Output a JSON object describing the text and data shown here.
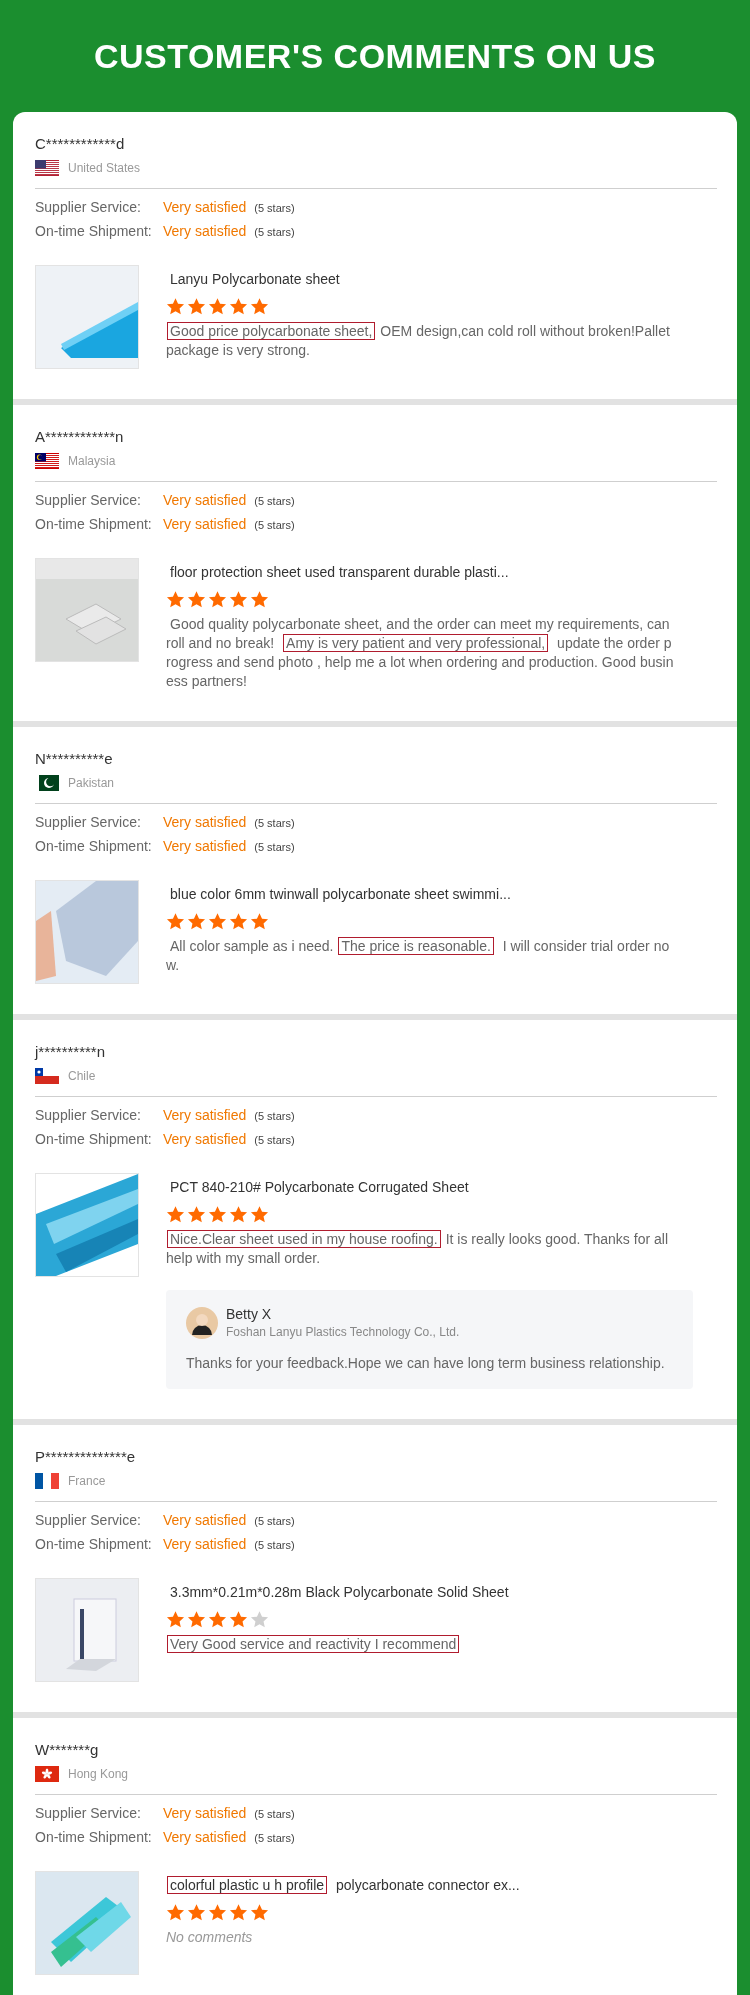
{
  "header": {
    "title": "CUSTOMER'S COMMENTS ON US"
  },
  "reviews": [
    {
      "name": "C************d",
      "country": "United States",
      "flag": {
        "kind": "us"
      },
      "ratings": [
        {
          "label": "Supplier Service:",
          "value": "Very satisfied",
          "note": "(5 stars)"
        },
        {
          "label": "On-time Shipment:",
          "value": "Very satisfied",
          "note": "(5 stars)"
        }
      ],
      "product": {
        "title": [
          {
            "text": "Lanyu Polycarbonate sheet",
            "highlighted": false
          }
        ],
        "stars": 5
      },
      "comment": {
        "kind": "text",
        "parts": [
          {
            "text": "Good price polycarbonate sheet,",
            "highlighted": true
          },
          {
            "text": "OEM design,can cold roll without broken!Pallet package is very strong.",
            "highlighted": false
          }
        ]
      }
    },
    {
      "name": "A************n",
      "country": "Malaysia",
      "flag": {
        "kind": "my"
      },
      "ratings": [
        {
          "label": "Supplier Service:",
          "value": "Very satisfied",
          "note": "(5 stars)"
        },
        {
          "label": "On-time Shipment:",
          "value": "Very satisfied",
          "note": "(5 stars)"
        }
      ],
      "product": {
        "title": [
          {
            "text": "floor protection sheet used transparent durable plasti...",
            "highlighted": false
          }
        ],
        "stars": 5
      },
      "comment": {
        "kind": "text",
        "parts": [
          {
            "text": "Good quality polycarbonate sheet,  and the order can meet my requirements, can roll and no break! ",
            "highlighted": false
          },
          {
            "text": "Amy is very patient and very professional,",
            "highlighted": true
          },
          {
            "text": " update the order progress and send photo , help me a lot when ordering and production. Good business partners!",
            "highlighted": false
          }
        ]
      }
    },
    {
      "name": "N**********e",
      "country": "Pakistan",
      "flag": {
        "kind": "pk"
      },
      "ratings": [
        {
          "label": "Supplier Service:",
          "value": "Very satisfied",
          "note": "(5 stars)"
        },
        {
          "label": "On-time Shipment:",
          "value": "Very satisfied",
          "note": "(5 stars)"
        }
      ],
      "product": {
        "title": [
          {
            "text": "blue color 6mm twinwall polycarbonate sheet swimmi...",
            "highlighted": false
          }
        ],
        "stars": 5
      },
      "comment": {
        "kind": "text",
        "parts": [
          {
            "text": "All color sample as i need.",
            "highlighted": false
          },
          {
            "text": "The price is reasonable.",
            "highlighted": true
          },
          {
            "text": " I will consider trial order now.",
            "highlighted": false
          }
        ]
      }
    },
    {
      "name": "j**********n",
      "country": "Chile",
      "flag": {
        "kind": "cl"
      },
      "ratings": [
        {
          "label": "Supplier Service:",
          "value": "Very satisfied",
          "note": "(5 stars)"
        },
        {
          "label": "On-time Shipment:",
          "value": "Very satisfied",
          "note": "(5 stars)"
        }
      ],
      "product": {
        "title": [
          {
            "text": "PCT 840-210# Polycarbonate Corrugated Sheet",
            "highlighted": false
          }
        ],
        "stars": 5
      },
      "comment": {
        "kind": "text",
        "parts": [
          {
            "text": "Nice.Clear sheet used in my house roofing.",
            "highlighted": true
          },
          {
            "text": "It is really looks good. Thanks for all help with my small order.",
            "highlighted": false
          }
        ]
      },
      "reply": {
        "name": "Betty X",
        "company": "Foshan Lanyu Plastics Technology Co., Ltd.",
        "text": "Thanks for your feedback.Hope we can have long term business relationship."
      }
    },
    {
      "name": "P**************e",
      "country": "France",
      "flag": {
        "kind": "fr"
      },
      "ratings": [
        {
          "label": "Supplier Service:",
          "value": "Very satisfied",
          "note": "(5 stars)"
        },
        {
          "label": "On-time Shipment:",
          "value": "Very satisfied",
          "note": "(5 stars)"
        }
      ],
      "product": {
        "title": [
          {
            "text": "3.3mm*0.21m*0.28m Black Polycarbonate Solid Sheet",
            "highlighted": false
          }
        ],
        "stars": 4
      },
      "comment": {
        "kind": "text",
        "parts": [
          {
            "text": "Very Good service and reactivity I recommend ",
            "highlighted": true
          }
        ]
      }
    },
    {
      "name": "W*******g",
      "country": "Hong Kong",
      "flag": {
        "kind": "hk"
      },
      "ratings": [
        {
          "label": "Supplier Service:",
          "value": "Very satisfied",
          "note": "(5 stars)"
        },
        {
          "label": "On-time Shipment:",
          "value": "Very satisfied",
          "note": "(5 stars)"
        }
      ],
      "product": {
        "title": [
          {
            "text": "colorful plastic u h profile",
            "highlighted": true
          },
          {
            "text": " polycarbonate connector ex...",
            "highlighted": false
          }
        ],
        "stars": 5
      },
      "comment": {
        "kind": "empty",
        "text": "No comments"
      }
    }
  ]
}
